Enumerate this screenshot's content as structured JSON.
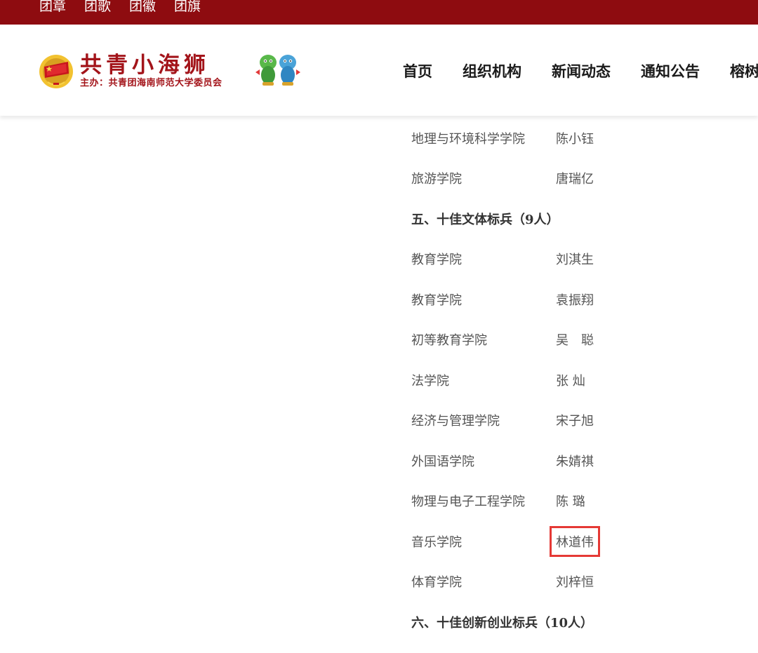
{
  "topbar": {
    "links": [
      "团章",
      "团歌",
      "团徽",
      "团旗"
    ]
  },
  "header": {
    "logo_title": "共青小海狮",
    "logo_subtitle": "主办：共青团海南师范大学委员会",
    "nav": [
      "首页",
      "组织机构",
      "新闻动态",
      "通知公告",
      "榕树"
    ]
  },
  "content": {
    "rows": [
      {
        "type": "entry",
        "college": "地理与环境科学学院",
        "person": "陈小钰"
      },
      {
        "type": "entry",
        "college": "旅游学院",
        "person": "唐瑞亿"
      },
      {
        "type": "section",
        "title": "五、十佳文体标兵（9人）"
      },
      {
        "type": "entry",
        "college": "教育学院",
        "person": "刘淇生"
      },
      {
        "type": "entry",
        "college": "教育学院",
        "person": "袁振翔"
      },
      {
        "type": "entry",
        "college": "初等教育学院",
        "person": "吴　聪"
      },
      {
        "type": "entry",
        "college": "法学院",
        "person": "张 灿"
      },
      {
        "type": "entry",
        "college": "经济与管理学院",
        "person": "宋子旭"
      },
      {
        "type": "entry",
        "college": "外国语学院",
        "person": "朱婧祺"
      },
      {
        "type": "entry",
        "college": "物理与电子工程学院",
        "person": "陈 璐"
      },
      {
        "type": "entry",
        "college": "音乐学院",
        "person": "林道伟",
        "highlighted": true
      },
      {
        "type": "entry",
        "college": "体育学院",
        "person": "刘梓恒"
      },
      {
        "type": "section",
        "title": "六、十佳创新创业标兵（10人）"
      }
    ]
  },
  "colors": {
    "topbar": "#8e0c10",
    "brand_red": "#a3141a",
    "highlight_box": "#e53935"
  }
}
